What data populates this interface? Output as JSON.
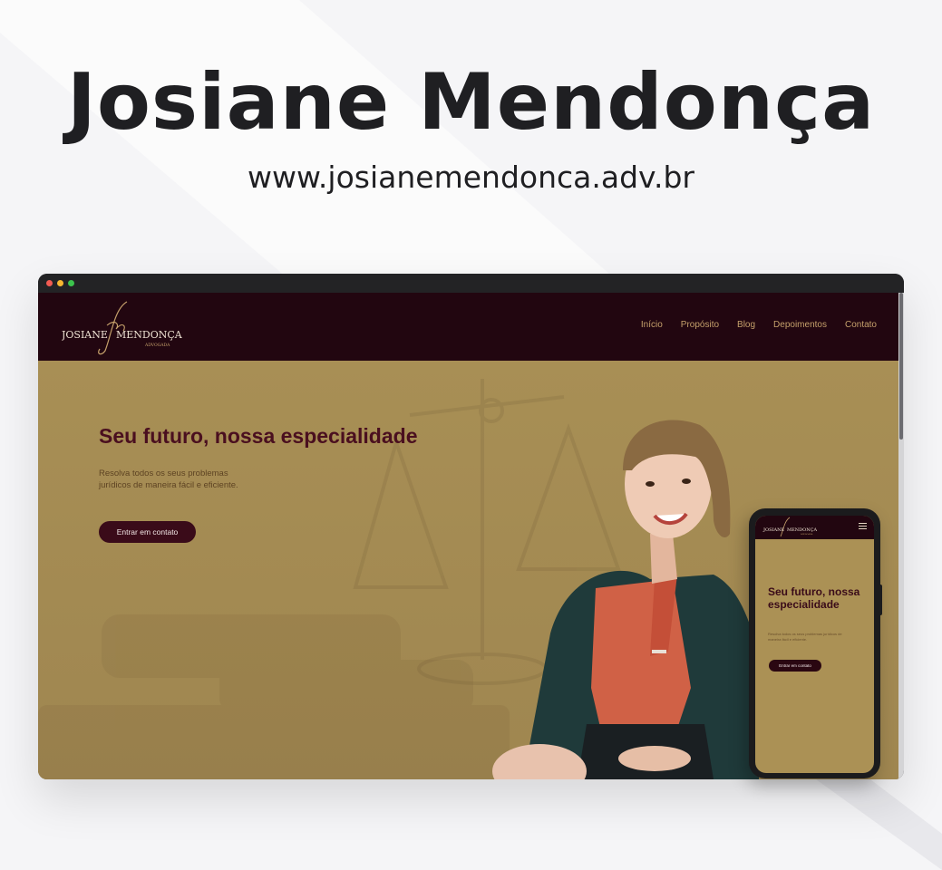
{
  "page": {
    "title": "Josiane Mendonça",
    "url": "www.josianemendonca.adv.br"
  },
  "site": {
    "logo": {
      "first": "JOSIANE",
      "last": "MENDONÇA",
      "role": "ADVOGADA",
      "monogram": "Jm"
    },
    "nav": [
      "Início",
      "Propósito",
      "Blog",
      "Depoimentos",
      "Contato"
    ],
    "hero": {
      "headline": "Seu futuro, nossa especialidade",
      "subtext": "Resolva todos os seus problemas jurídicos de maneira fácil e eficiente.",
      "cta": "Entrar em contato"
    }
  },
  "mobile": {
    "headline": "Seu futuro, nossa especialidade",
    "subtext": "Resolva todos os seus problemas jurídicos de maneira fácil e eficiente.",
    "cta": "Entrar em contato"
  },
  "colors": {
    "background": "#f5f5f7",
    "navbar": "#220610",
    "hero": "#a88f54",
    "accent": "#c5a06b",
    "headline": "#4a0f1f",
    "button": "#3a0b19"
  },
  "icons": [
    "window-close-dot",
    "window-minimize-dot",
    "window-maximize-dot",
    "hamburger-menu-icon"
  ]
}
